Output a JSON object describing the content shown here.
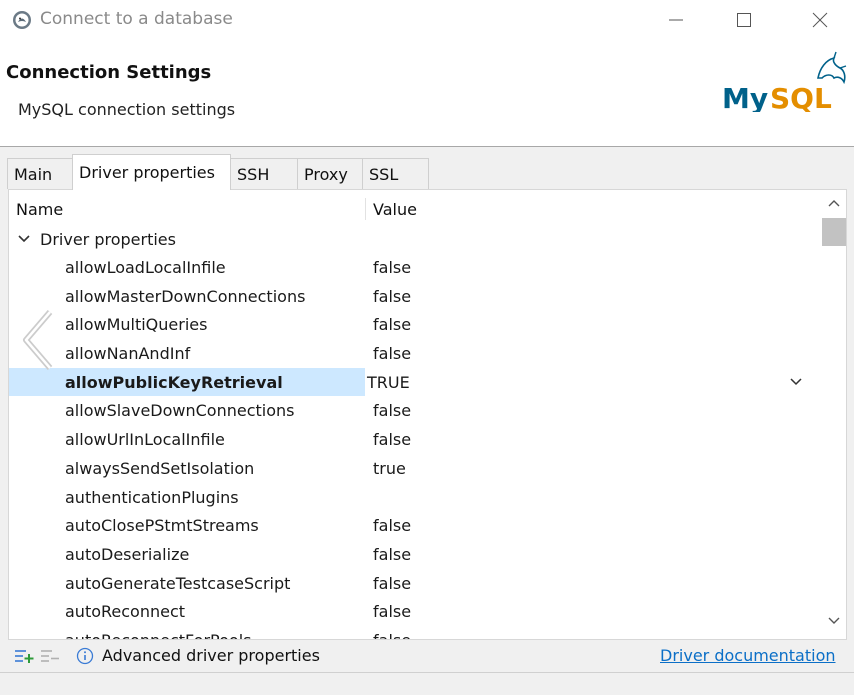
{
  "window": {
    "title": "Connect to a database"
  },
  "header": {
    "title": "Connection Settings",
    "description": "MySQL connection settings",
    "logo_text": "MySQL"
  },
  "tabs": [
    {
      "label": "Main",
      "active": false
    },
    {
      "label": "Driver properties",
      "active": true
    },
    {
      "label": "SSH",
      "active": false
    },
    {
      "label": "Proxy",
      "active": false
    },
    {
      "label": "SSL",
      "active": false
    }
  ],
  "table": {
    "col_name": "Name",
    "col_value": "Value",
    "group_label": "Driver properties",
    "rows": [
      {
        "name": "allowLoadLocalInfile",
        "value": "false"
      },
      {
        "name": "allowMasterDownConnections",
        "value": "false"
      },
      {
        "name": "allowMultiQueries",
        "value": "false"
      },
      {
        "name": "allowNanAndInf",
        "value": "false"
      },
      {
        "name": "allowPublicKeyRetrieval",
        "value": "TRUE"
      },
      {
        "name": "allowSlaveDownConnections",
        "value": "false"
      },
      {
        "name": "allowUrlInLocalInfile",
        "value": "false"
      },
      {
        "name": "alwaysSendSetIsolation",
        "value": "true"
      },
      {
        "name": "authenticationPlugins",
        "value": ""
      },
      {
        "name": "autoClosePStmtStreams",
        "value": "false"
      },
      {
        "name": "autoDeserialize",
        "value": "false"
      },
      {
        "name": "autoGenerateTestcaseScript",
        "value": "false"
      },
      {
        "name": "autoReconnect",
        "value": "false"
      },
      {
        "name": "autoReconnectForPools",
        "value": "false"
      }
    ]
  },
  "footer": {
    "advanced_label": "Advanced driver properties",
    "doc_link": "Driver documentation"
  },
  "colors": {
    "selection": "#cde8ff",
    "link": "#0b6fc7",
    "mysql_blue": "#00618a",
    "mysql_orange": "#e48e00",
    "add_icon_green": "#2e9b3a"
  }
}
